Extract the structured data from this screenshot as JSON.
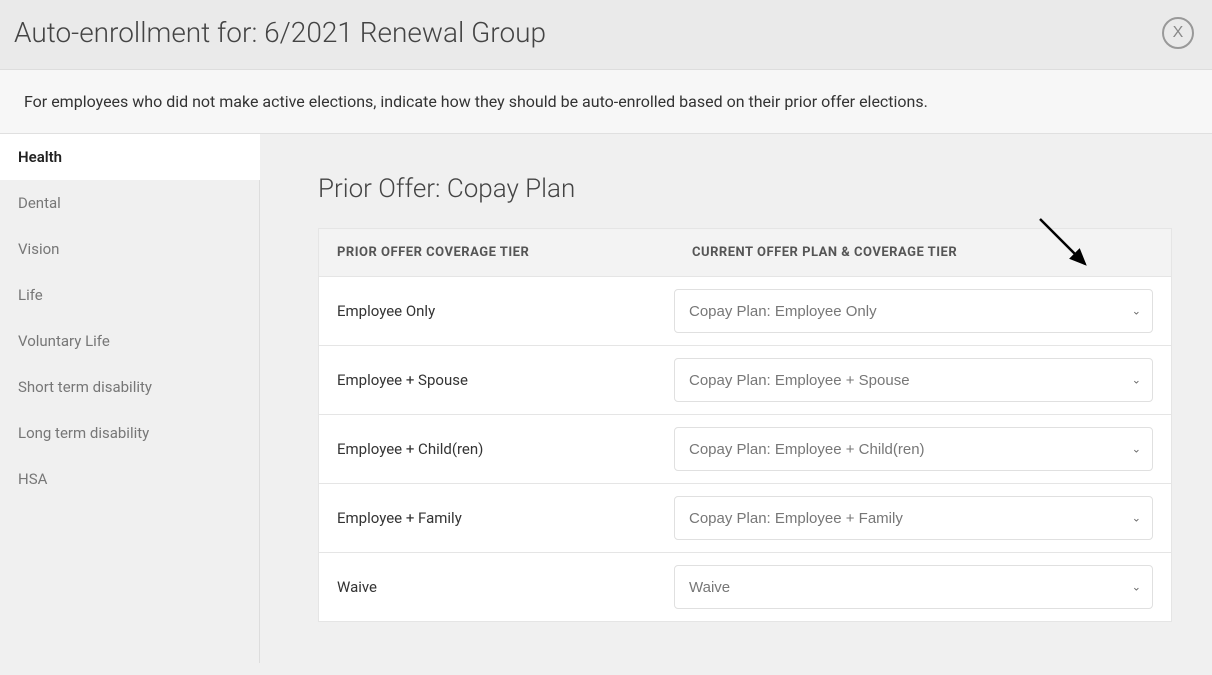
{
  "header": {
    "title": "Auto-enrollment for: 6/2021 Renewal Group",
    "close_label": "X"
  },
  "description": "For employees who did not make active elections, indicate how they should be auto-enrolled based on their prior offer elections.",
  "sidebar": {
    "items": [
      {
        "label": "Health",
        "active": true
      },
      {
        "label": "Dental",
        "active": false
      },
      {
        "label": "Vision",
        "active": false
      },
      {
        "label": "Life",
        "active": false
      },
      {
        "label": "Voluntary Life",
        "active": false
      },
      {
        "label": "Short term disability",
        "active": false
      },
      {
        "label": "Long term disability",
        "active": false
      },
      {
        "label": "HSA",
        "active": false
      }
    ]
  },
  "main": {
    "prior_offer_title": "Prior Offer: Copay Plan",
    "columns": {
      "prior": "PRIOR OFFER COVERAGE TIER",
      "current": "CURRENT OFFER PLAN & COVERAGE TIER"
    },
    "rows": [
      {
        "tier": "Employee Only",
        "selected": "Copay Plan: Employee Only"
      },
      {
        "tier": "Employee + Spouse",
        "selected": "Copay Plan: Employee + Spouse"
      },
      {
        "tier": "Employee + Child(ren)",
        "selected": "Copay Plan: Employee + Child(ren)"
      },
      {
        "tier": "Employee + Family",
        "selected": "Copay Plan: Employee + Family"
      },
      {
        "tier": "Waive",
        "selected": "Waive"
      }
    ]
  }
}
